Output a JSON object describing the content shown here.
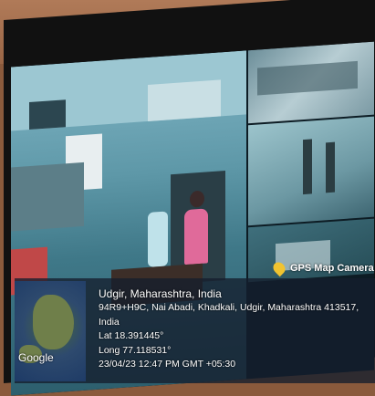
{
  "location": {
    "place": "Udgir, Maharashtra, India",
    "address": "94R9+H9C, Nai Abadi, Khadkali, Udgir, Maharashtra 413517, India",
    "latitude": "Lat 18.391445°",
    "longitude": "Long 77.118531°",
    "datetime": "23/04/23 12:47 PM GMT +05:30"
  },
  "map": {
    "attribution": "Google"
  },
  "app": {
    "badge_label": "GPS Map Camera",
    "badge_icon": "map-pin-icon"
  },
  "colors": {
    "overlay": "#14202d",
    "badge_pin": "#f0c330"
  }
}
